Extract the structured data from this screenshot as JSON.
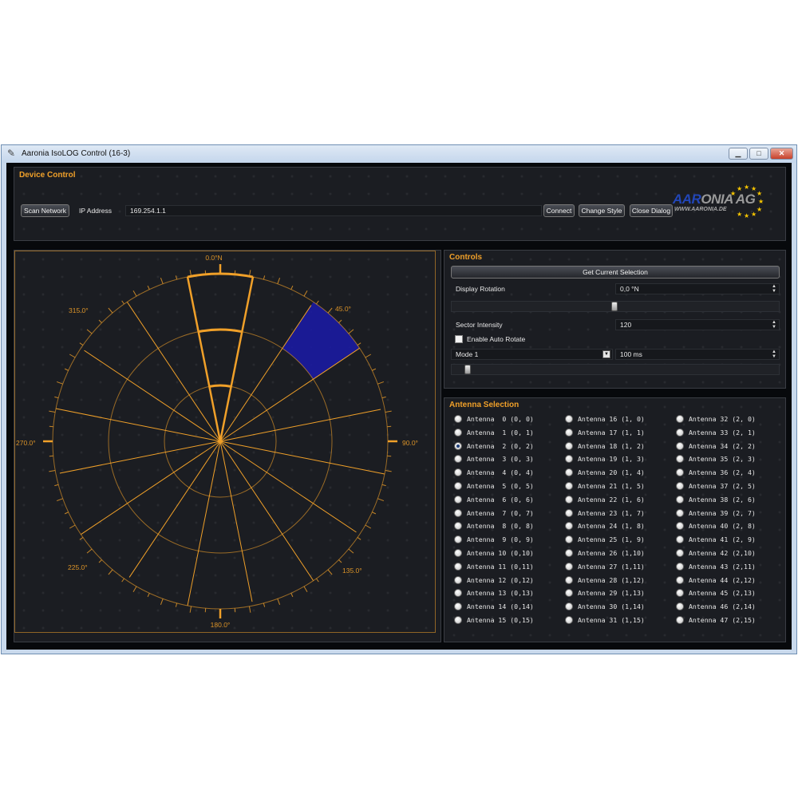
{
  "window": {
    "title": "Aaronia IsoLOG Control (16-3)"
  },
  "device_control": {
    "title": "Device Control",
    "scan_network": "Scan Network",
    "ip_label": "IP Address",
    "ip_value": "169.254.1.1",
    "connect": "Connect",
    "change_style": "Change Style",
    "close_dialog": "Close Dialog",
    "logo": {
      "main_a": "AAR",
      "main_b": "ONIA AG",
      "sub": "WWW.AARONIA.DE"
    }
  },
  "polar": {
    "labels": [
      "0.0°N",
      "45.0°",
      "90.0°",
      "135.0°",
      "180.0°",
      "225.0°",
      "270.0°",
      "315.0°"
    ],
    "selected_sector_deg": 45,
    "accent_color": "#f0a029",
    "selection_color": "#1a1aa8"
  },
  "controls": {
    "title": "Controls",
    "get_selection": "Get Current Selection",
    "display_rotation_label": "Display Rotation",
    "display_rotation_value": "0,0 °N",
    "sector_intensity_label": "Sector Intensity",
    "sector_intensity_value": "120",
    "auto_rotate_label": "Enable Auto Rotate",
    "auto_rotate_checked": false,
    "mode_value": "Mode 1",
    "interval_value": "100 ms"
  },
  "antenna_selection": {
    "title": "Antenna Selection",
    "selected_index": 2,
    "columns": [
      [
        "Antenna  0 (0, 0)",
        "Antenna  1 (0, 1)",
        "Antenna  2 (0, 2)",
        "Antenna  3 (0, 3)",
        "Antenna  4 (0, 4)",
        "Antenna  5 (0, 5)",
        "Antenna  6 (0, 6)",
        "Antenna  7 (0, 7)",
        "Antenna  8 (0, 8)",
        "Antenna  9 (0, 9)",
        "Antenna 10 (0,10)",
        "Antenna 11 (0,11)",
        "Antenna 12 (0,12)",
        "Antenna 13 (0,13)",
        "Antenna 14 (0,14)",
        "Antenna 15 (0,15)"
      ],
      [
        "Antenna 16 (1, 0)",
        "Antenna 17 (1, 1)",
        "Antenna 18 (1, 2)",
        "Antenna 19 (1, 3)",
        "Antenna 20 (1, 4)",
        "Antenna 21 (1, 5)",
        "Antenna 22 (1, 6)",
        "Antenna 23 (1, 7)",
        "Antenna 24 (1, 8)",
        "Antenna 25 (1, 9)",
        "Antenna 26 (1,10)",
        "Antenna 27 (1,11)",
        "Antenna 28 (1,12)",
        "Antenna 29 (1,13)",
        "Antenna 30 (1,14)",
        "Antenna 31 (1,15)"
      ],
      [
        "Antenna 32 (2, 0)",
        "Antenna 33 (2, 1)",
        "Antenna 34 (2, 2)",
        "Antenna 35 (2, 3)",
        "Antenna 36 (2, 4)",
        "Antenna 37 (2, 5)",
        "Antenna 38 (2, 6)",
        "Antenna 39 (2, 7)",
        "Antenna 40 (2, 8)",
        "Antenna 41 (2, 9)",
        "Antenna 42 (2,10)",
        "Antenna 43 (2,11)",
        "Antenna 44 (2,12)",
        "Antenna 45 (2,13)",
        "Antenna 46 (2,14)",
        "Antenna 47 (2,15)"
      ]
    ]
  }
}
